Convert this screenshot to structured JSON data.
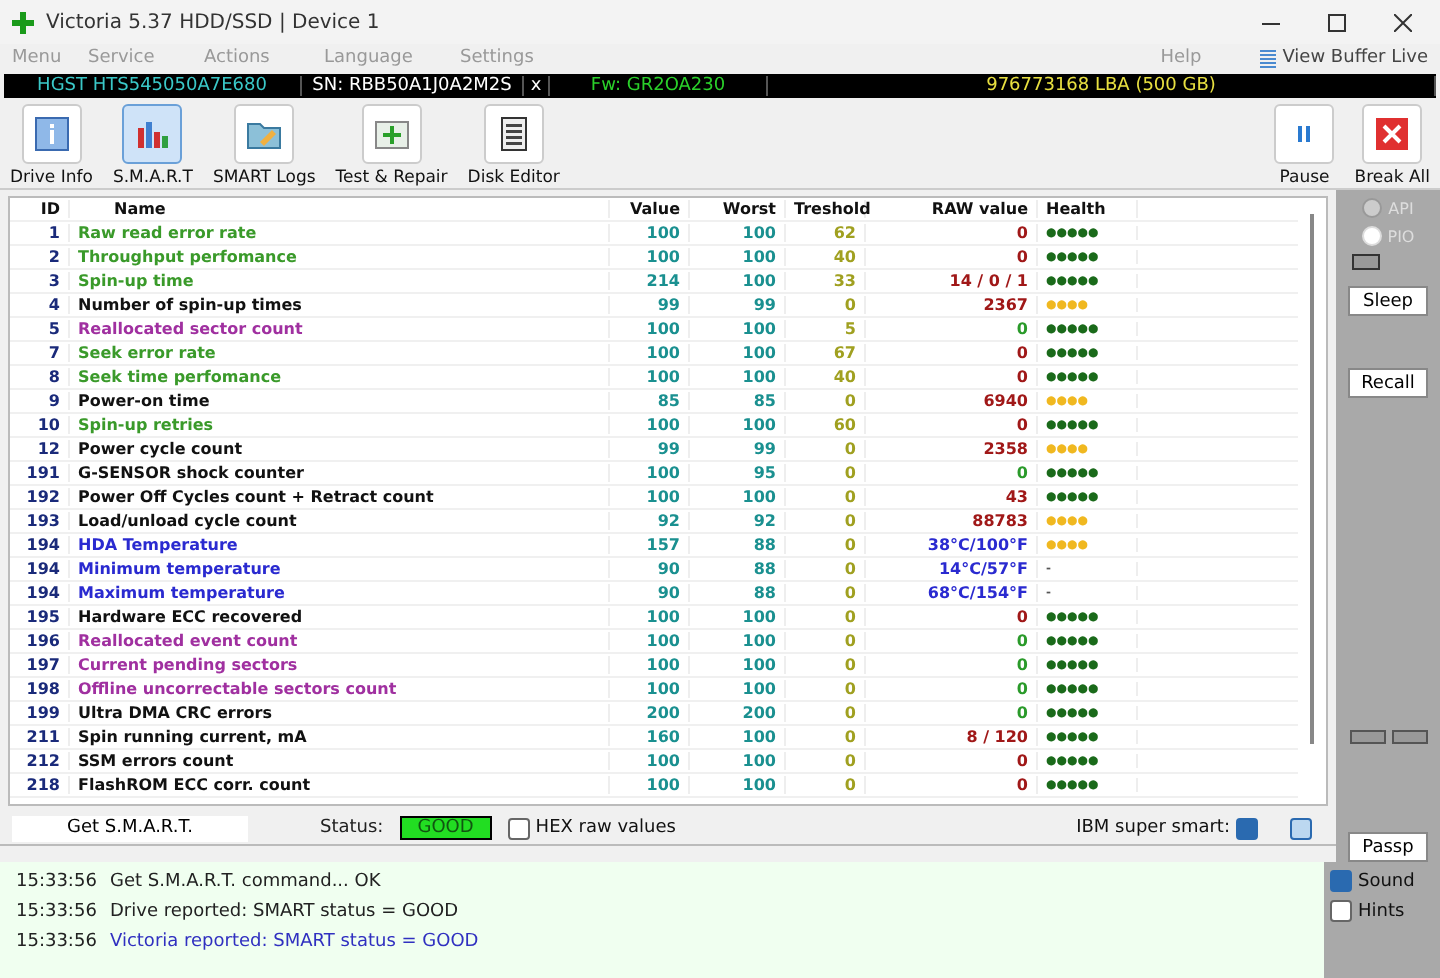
{
  "window": {
    "title": "Victoria 5.37 HDD/SSD | Device 1"
  },
  "menu": [
    "Menu",
    "Service",
    "Actions",
    "Language",
    "Settings",
    "Help"
  ],
  "view_buffer": "View Buffer Live",
  "drive_bar": {
    "model": "HGST HTS545050A7E680",
    "serial": "SN: RBB50A1J0A2M2S",
    "close": "x",
    "firmware": "Fw: GR2OA230",
    "capacity": "976773168 LBA (500 GB)"
  },
  "toolbar": [
    {
      "label": "Drive Info",
      "kind": "info",
      "selected": false
    },
    {
      "label": "S.M.A.R.T",
      "kind": "smart",
      "selected": true
    },
    {
      "label": "SMART Logs",
      "kind": "logs",
      "selected": false
    },
    {
      "label": "Test & Repair",
      "kind": "test",
      "selected": false
    },
    {
      "label": "Disk Editor",
      "kind": "editor",
      "selected": false
    }
  ],
  "toolbar_right": [
    {
      "label": "Pause",
      "kind": "pause"
    },
    {
      "label": "Break All",
      "kind": "break"
    }
  ],
  "table": {
    "columns": [
      "ID",
      "Name",
      "Value",
      "Worst",
      "Treshold",
      "RAW value",
      "Health"
    ],
    "rows": [
      {
        "id": "1",
        "name": "Raw read error rate",
        "color": "#3a9a2a",
        "value": "100",
        "worst": "100",
        "threshold": "62",
        "raw": {
          "text": "0",
          "color": "#a01818"
        },
        "health": {
          "text": "●●●●●",
          "color": "#1a6a1a"
        }
      },
      {
        "id": "2",
        "name": "Throughput perfomance",
        "color": "#3a9a2a",
        "value": "100",
        "worst": "100",
        "threshold": "40",
        "raw": {
          "text": "0",
          "color": "#a01818"
        },
        "health": {
          "text": "●●●●●",
          "color": "#1a6a1a"
        }
      },
      {
        "id": "3",
        "name": "Spin-up time",
        "color": "#3a9a2a",
        "value": "214",
        "worst": "100",
        "threshold": "33",
        "raw": {
          "text": "14 / 0 / 1",
          "color": "#a01818"
        },
        "health": {
          "text": "●●●●●",
          "color": "#1a6a1a"
        }
      },
      {
        "id": "4",
        "name": "Number of spin-up times",
        "color": "#111111",
        "value": "99",
        "worst": "99",
        "threshold": "0",
        "raw": {
          "text": "2367",
          "color": "#a01818"
        },
        "health": {
          "text": "●●●●",
          "color": "#f0b820"
        }
      },
      {
        "id": "5",
        "name": "Reallocated sector count",
        "color": "#a030a0",
        "value": "100",
        "worst": "100",
        "threshold": "5",
        "raw": {
          "text": "0",
          "color": "#2a9a2a"
        },
        "health": {
          "text": "●●●●●",
          "color": "#1a6a1a"
        }
      },
      {
        "id": "7",
        "name": "Seek error rate",
        "color": "#3a9a2a",
        "value": "100",
        "worst": "100",
        "threshold": "67",
        "raw": {
          "text": "0",
          "color": "#a01818"
        },
        "health": {
          "text": "●●●●●",
          "color": "#1a6a1a"
        }
      },
      {
        "id": "8",
        "name": "Seek time perfomance",
        "color": "#3a9a2a",
        "value": "100",
        "worst": "100",
        "threshold": "40",
        "raw": {
          "text": "0",
          "color": "#a01818"
        },
        "health": {
          "text": "●●●●●",
          "color": "#1a6a1a"
        }
      },
      {
        "id": "9",
        "name": "Power-on time",
        "color": "#111111",
        "value": "85",
        "worst": "85",
        "threshold": "0",
        "raw": {
          "text": "6940",
          "color": "#a01818"
        },
        "health": {
          "text": "●●●●",
          "color": "#f0b820"
        }
      },
      {
        "id": "10",
        "name": "Spin-up retries",
        "color": "#3a9a2a",
        "value": "100",
        "worst": "100",
        "threshold": "60",
        "raw": {
          "text": "0",
          "color": "#a01818"
        },
        "health": {
          "text": "●●●●●",
          "color": "#1a6a1a"
        }
      },
      {
        "id": "12",
        "name": "Power cycle count",
        "color": "#111111",
        "value": "99",
        "worst": "99",
        "threshold": "0",
        "raw": {
          "text": "2358",
          "color": "#a01818"
        },
        "health": {
          "text": "●●●●",
          "color": "#f0b820"
        }
      },
      {
        "id": "191",
        "name": "G-SENSOR shock counter",
        "color": "#111111",
        "value": "100",
        "worst": "95",
        "threshold": "0",
        "raw": {
          "text": "0",
          "color": "#2a9a2a"
        },
        "health": {
          "text": "●●●●●",
          "color": "#1a6a1a"
        }
      },
      {
        "id": "192",
        "name": "Power Off Cycles count + Retract count",
        "color": "#111111",
        "value": "100",
        "worst": "100",
        "threshold": "0",
        "raw": {
          "text": "43",
          "color": "#a01818"
        },
        "health": {
          "text": "●●●●●",
          "color": "#1a6a1a"
        }
      },
      {
        "id": "193",
        "name": "Load/unload cycle count",
        "color": "#111111",
        "value": "92",
        "worst": "92",
        "threshold": "0",
        "raw": {
          "text": "88783",
          "color": "#a01818"
        },
        "health": {
          "text": "●●●●",
          "color": "#f0b820"
        }
      },
      {
        "id": "194",
        "name": "HDA Temperature",
        "color": "#2a2ad0",
        "value": "157",
        "worst": "88",
        "threshold": "0",
        "raw": {
          "text": "38°C/100°F",
          "color": "#2a2ad0"
        },
        "health": {
          "text": "●●●●",
          "color": "#f0b820"
        }
      },
      {
        "id": "194",
        "name": "Minimum temperature",
        "color": "#2a2ad0",
        "value": "90",
        "worst": "88",
        "threshold": "0",
        "raw": {
          "text": "14°C/57°F",
          "color": "#2a2ad0"
        },
        "health": {
          "text": "-",
          "color": "#555555"
        }
      },
      {
        "id": "194",
        "name": "Maximum temperature",
        "color": "#2a2ad0",
        "value": "90",
        "worst": "88",
        "threshold": "0",
        "raw": {
          "text": "68°C/154°F",
          "color": "#2a2ad0"
        },
        "health": {
          "text": "-",
          "color": "#555555"
        }
      },
      {
        "id": "195",
        "name": "Hardware ECC recovered",
        "color": "#111111",
        "value": "100",
        "worst": "100",
        "threshold": "0",
        "raw": {
          "text": "0",
          "color": "#a01818"
        },
        "health": {
          "text": "●●●●●",
          "color": "#1a6a1a"
        }
      },
      {
        "id": "196",
        "name": "Reallocated event count",
        "color": "#a030a0",
        "value": "100",
        "worst": "100",
        "threshold": "0",
        "raw": {
          "text": "0",
          "color": "#2a9a2a"
        },
        "health": {
          "text": "●●●●●",
          "color": "#1a6a1a"
        }
      },
      {
        "id": "197",
        "name": "Current pending sectors",
        "color": "#a030a0",
        "value": "100",
        "worst": "100",
        "threshold": "0",
        "raw": {
          "text": "0",
          "color": "#2a9a2a"
        },
        "health": {
          "text": "●●●●●",
          "color": "#1a6a1a"
        }
      },
      {
        "id": "198",
        "name": "Offline uncorrectable sectors count",
        "color": "#a030a0",
        "value": "100",
        "worst": "100",
        "threshold": "0",
        "raw": {
          "text": "0",
          "color": "#2a9a2a"
        },
        "health": {
          "text": "●●●●●",
          "color": "#1a6a1a"
        }
      },
      {
        "id": "199",
        "name": "Ultra DMA CRC errors",
        "color": "#111111",
        "value": "200",
        "worst": "200",
        "threshold": "0",
        "raw": {
          "text": "0",
          "color": "#2a9a2a"
        },
        "health": {
          "text": "●●●●●",
          "color": "#1a6a1a"
        }
      },
      {
        "id": "211",
        "name": "Spin running current, mA",
        "color": "#111111",
        "value": "160",
        "worst": "100",
        "threshold": "0",
        "raw": {
          "text": "8 / 120",
          "color": "#a01818"
        },
        "health": {
          "text": "●●●●●",
          "color": "#1a6a1a"
        }
      },
      {
        "id": "212",
        "name": "SSM errors count",
        "color": "#111111",
        "value": "100",
        "worst": "100",
        "threshold": "0",
        "raw": {
          "text": "0",
          "color": "#a01818"
        },
        "health": {
          "text": "●●●●●",
          "color": "#1a6a1a"
        }
      },
      {
        "id": "218",
        "name": "FlashROM ECC corr. count",
        "color": "#111111",
        "value": "100",
        "worst": "100",
        "threshold": "0",
        "raw": {
          "text": "0",
          "color": "#a01818"
        },
        "health": {
          "text": "●●●●●",
          "color": "#1a6a1a"
        }
      }
    ]
  },
  "side_panel": {
    "radios": [
      {
        "label": "API",
        "selected": true,
        "disabled": true
      },
      {
        "label": "PIO",
        "selected": false,
        "disabled": true
      }
    ],
    "buttons": [
      "Sleep",
      "Recall"
    ],
    "passp": "Passp"
  },
  "status_row": {
    "get_button": "Get S.M.A.R.T.",
    "status_label": "Status:",
    "status": "GOOD",
    "hex": {
      "label": "HEX raw values",
      "checked": false
    },
    "ibm": {
      "label": "IBM super smart:",
      "checked": true
    },
    "extra_checked": false
  },
  "log": [
    {
      "time": "15:33:56",
      "text": "Get S.M.A.R.T. command... OK",
      "kind": "normal"
    },
    {
      "time": "15:33:56",
      "text": "Drive reported: SMART status = GOOD",
      "kind": "normal"
    },
    {
      "time": "15:33:56",
      "text": "Victoria reported: SMART status = GOOD",
      "kind": "info"
    }
  ],
  "log_options": [
    {
      "label": "Sound",
      "checked": true
    },
    {
      "label": "Hints",
      "checked": false
    }
  ]
}
